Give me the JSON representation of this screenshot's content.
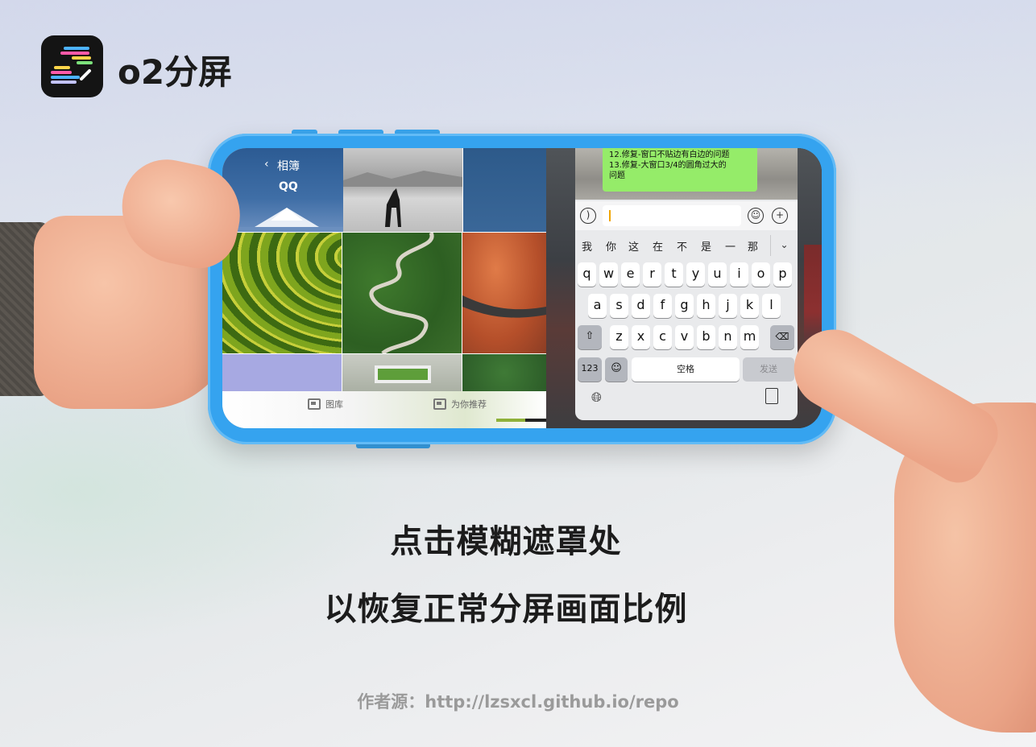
{
  "brand": {
    "icon": "o2-split-app-icon",
    "name": "o2分屏"
  },
  "album": {
    "back_label": "相簿",
    "title": "QQ",
    "tabs": [
      {
        "label": "图库",
        "icon": "gallery-icon"
      },
      {
        "label": "为你推荐",
        "icon": "recommend-icon"
      }
    ]
  },
  "chat": {
    "message_lines": [
      "12.修复-窗口不贴边有白边的问题",
      "13.修复-大窗口3/4的圆角过大的",
      "问题"
    ],
    "input_value": "",
    "candidates": [
      "我",
      "你",
      "这",
      "在",
      "不",
      "是",
      "一",
      "那"
    ],
    "keyboard": {
      "row1": [
        "q",
        "w",
        "e",
        "r",
        "t",
        "y",
        "u",
        "i",
        "o",
        "p"
      ],
      "row2": [
        "a",
        "s",
        "d",
        "f",
        "g",
        "h",
        "j",
        "k",
        "l"
      ],
      "row3": [
        "z",
        "x",
        "c",
        "v",
        "b",
        "n",
        "m"
      ],
      "num_label": "123",
      "space_label": "空格",
      "send_label": "发送"
    }
  },
  "caption": {
    "line1": "点击模糊遮罩处",
    "line2": "以恢复正常分屏画面比例"
  },
  "credit": "作者源：http://lzsxcl.github.io/repo",
  "colors": {
    "phone_frame": "#35a3ef",
    "chat_bubble": "#95ec69",
    "caption_text": "#1c1c1c"
  }
}
